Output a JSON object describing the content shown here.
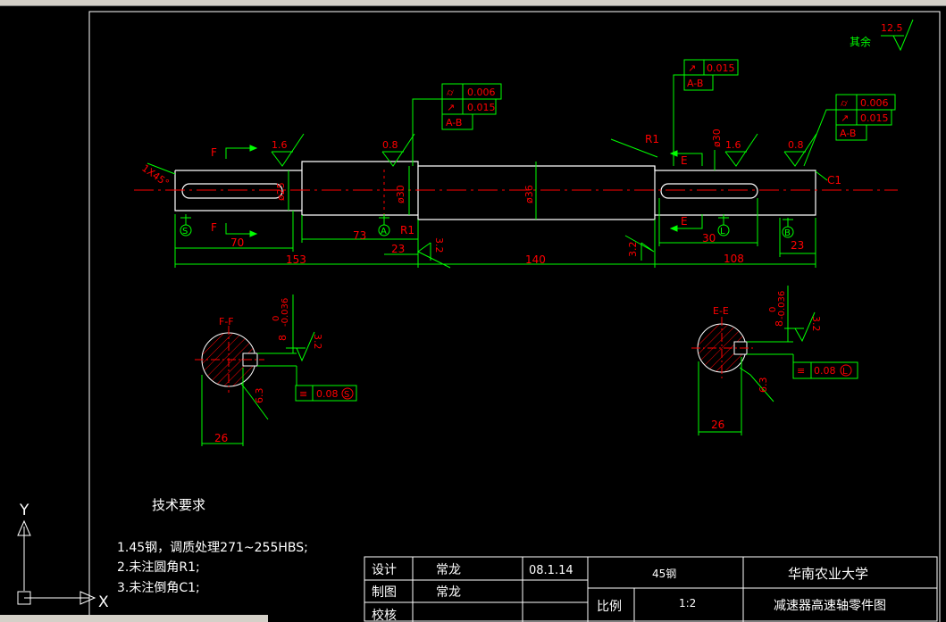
{
  "drawing": {
    "roughness_rest": "其余",
    "roughness_rest_value": "12.5",
    "section_ff": "F-F",
    "section_ee": "E-E",
    "label_f": "F",
    "label_e": "E",
    "r1": "R1",
    "c1": "C1",
    "chamfer": "1X45°"
  },
  "fcf": {
    "mid_circ": "0.006",
    "mid_runout": "0.015",
    "mid_datum": "A-B",
    "right_runout": "0.015",
    "right_datum": "A-B",
    "far_circ": "0.006",
    "far_runout": "0.015",
    "far_datum": "A-B",
    "sym_left": "0.08",
    "sym_left_ref": "S",
    "sym_right": "0.08",
    "sym_right_ref": "L"
  },
  "dims": {
    "d153": "153",
    "d70": "70",
    "d73": "73",
    "d23a": "23",
    "d140": "140",
    "d108": "108",
    "d30": "30",
    "d23b": "23",
    "d26a": "26",
    "d26b": "26",
    "phi25": "ø25",
    "phi30a": "ø30",
    "phi36": "ø36",
    "phi30b": "ø30",
    "key8a": "8",
    "tol_a_upper": "0",
    "tol_a_lower": "-0.036",
    "key8b": "8",
    "tol_b_upper": "0",
    "tol_b_lower": "-0.036"
  },
  "roughness": {
    "r16a": "1.6",
    "r08a": "0.8",
    "r16b": "1.6",
    "r08b": "0.8",
    "r32a": "3.2",
    "r32b": "3.2",
    "r32c": "3.2",
    "r32d": "3.2",
    "r63a": "6.3",
    "r63b": "6.3"
  },
  "datum": {
    "s": "S",
    "a": "A",
    "l": "L",
    "b": "B"
  },
  "tech": {
    "title": "技术要求",
    "line1": "1.45钢，调质处理271~255HBS;",
    "line2": "2.未注圆角R1;",
    "line3": "3.未注倒角C1;"
  },
  "titleblock": {
    "design_lbl": "设计",
    "design_name": "常龙",
    "date": "08.1.14",
    "material": "45钢",
    "school": "华南农业大学",
    "draw_lbl": "制图",
    "draw_name": "常龙",
    "check_lbl": "校核",
    "scale_lbl": "比例",
    "scale": "1:2",
    "part_name": "减速器高速轴零件图"
  },
  "ucs": {
    "y": "Y",
    "x": "X"
  },
  "colors": {
    "line": "#ffffff",
    "dim": "#00ff00",
    "center": "#ff0000",
    "hatch": "#ff0000",
    "bg": "#000000"
  }
}
